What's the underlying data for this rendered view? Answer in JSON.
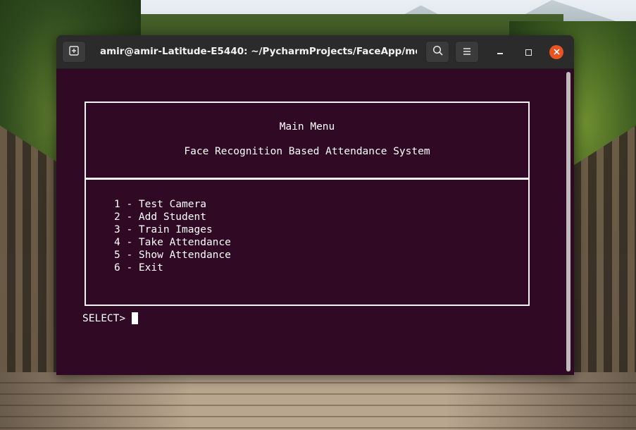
{
  "window": {
    "title": "amir@amir-Latitude-E5440: ~/PycharmProjects/FaceApp/mo..."
  },
  "terminal": {
    "header_line_1": "Main Menu",
    "header_line_2": "Face Recognition Based Attendance System",
    "menu_items": [
      "1 - Test Camera",
      "2 - Add Student",
      "3 - Train Images",
      "4 - Take Attendance",
      "5 - Show Attendance",
      "6 - Exit"
    ],
    "prompt": "SELECT>"
  },
  "icons": {
    "new_tab": "new-tab-icon",
    "search": "search-icon",
    "menu": "hamburger-menu-icon",
    "minimize": "minimize-icon",
    "maximize": "maximize-icon",
    "close": "close-icon"
  },
  "colors": {
    "terminal_background": "#300a24",
    "titlebar": "#2b2b2b",
    "close_button": "#e95420",
    "text": "#ffffff"
  }
}
